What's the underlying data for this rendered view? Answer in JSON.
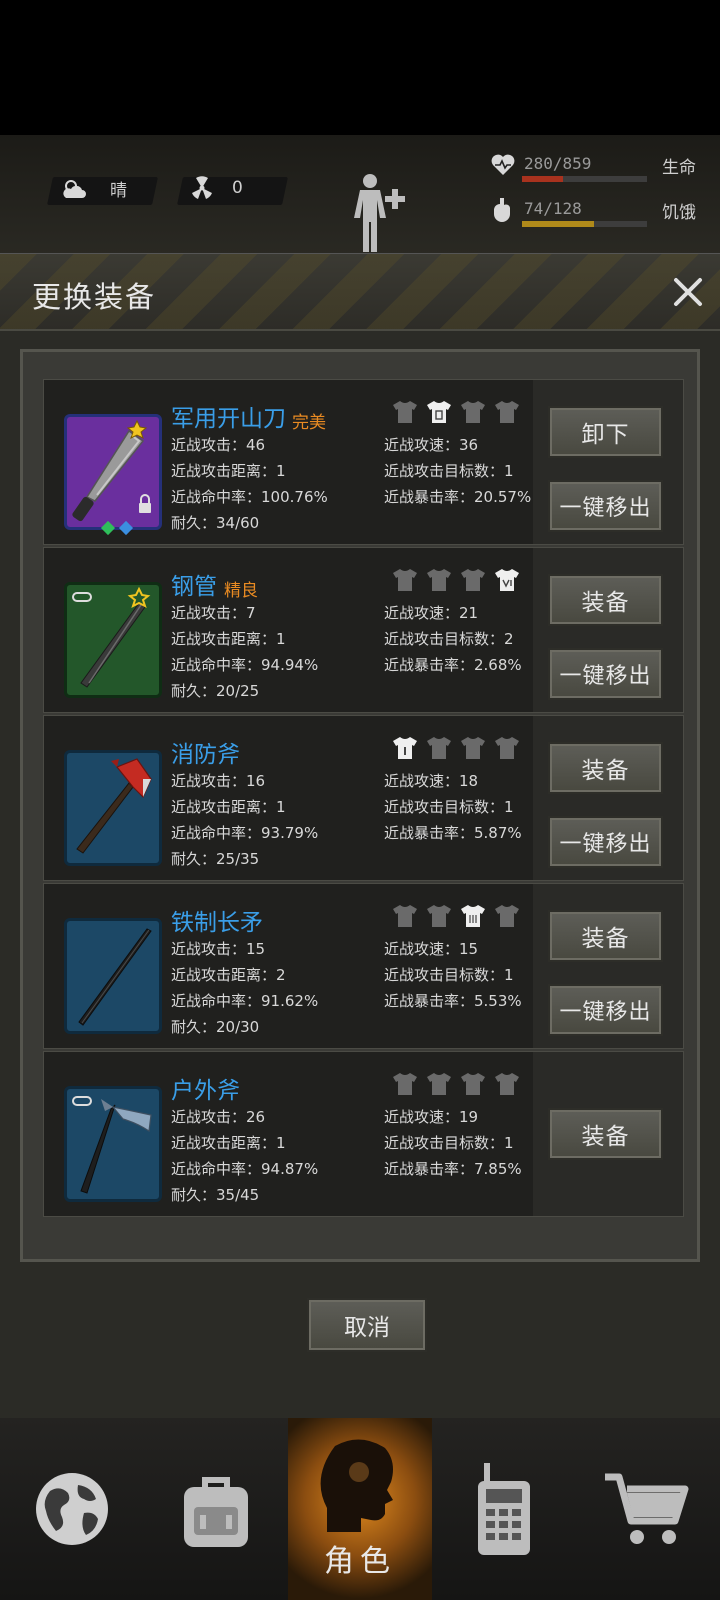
{
  "status": {
    "weather_label": "晴",
    "radiation_value": "0",
    "health_value": "280/859",
    "health_label": "生命",
    "health_level": 0.326,
    "hunger_value": "74/128",
    "hunger_label": "饥饿",
    "hunger_level": 0.578,
    "colors": {
      "health": "#a8321e",
      "hunger": "#b08a1a"
    }
  },
  "dialog": {
    "title": "更换装备",
    "cancel_label": "取消"
  },
  "items": [
    {
      "name": "军用开山刀",
      "quality": "完美",
      "melee_attack": "近战攻击：46",
      "melee_speed": "近战攻速：36",
      "melee_range": "近战攻击距离：1",
      "melee_targets": "近战攻击目标数：1",
      "melee_hit": "近战命中率：100.76%",
      "melee_crit": "近战暴击率：20.57%",
      "durability": "耐久：34/60",
      "primary_action": "卸下",
      "secondary_action": "一键移出",
      "rarity_color": "#6a2f9e",
      "icon": "machete-icon"
    },
    {
      "name": "钢管",
      "quality": "精良",
      "melee_attack": "近战攻击：7",
      "melee_speed": "近战攻速：21",
      "melee_range": "近战攻击距离：1",
      "melee_targets": "近战攻击目标数：2",
      "melee_hit": "近战命中率：94.94%",
      "melee_crit": "近战暴击率：2.68%",
      "durability": "耐久：20/25",
      "primary_action": "装备",
      "secondary_action": "一键移出",
      "rarity_color": "#23572a",
      "icon": "steel-pipe-icon"
    },
    {
      "name": "消防斧",
      "quality": "",
      "melee_attack": "近战攻击：16",
      "melee_speed": "近战攻速：18",
      "melee_range": "近战攻击距离：1",
      "melee_targets": "近战攻击目标数：1",
      "melee_hit": "近战命中率：93.79%",
      "melee_crit": "近战暴击率：5.87%",
      "durability": "耐久：25/35",
      "primary_action": "装备",
      "secondary_action": "一键移出",
      "rarity_color": "#1c4866",
      "icon": "fire-axe-icon"
    },
    {
      "name": "铁制长矛",
      "quality": "",
      "melee_attack": "近战攻击：15",
      "melee_speed": "近战攻速：15",
      "melee_range": "近战攻击距离：2",
      "melee_targets": "近战攻击目标数：1",
      "melee_hit": "近战命中率：91.62%",
      "melee_crit": "近战暴击率：5.53%",
      "durability": "耐久：20/30",
      "primary_action": "装备",
      "secondary_action": "一键移出",
      "rarity_color": "#1c4866",
      "icon": "spear-icon"
    },
    {
      "name": "户外斧",
      "quality": "",
      "melee_attack": "近战攻击：26",
      "melee_speed": "近战攻速：19",
      "melee_range": "近战攻击距离：1",
      "melee_targets": "近战攻击目标数：1",
      "melee_hit": "近战命中率：94.87%",
      "melee_crit": "近战暴击率：7.85%",
      "durability": "耐久：35/45",
      "primary_action": "装备",
      "rarity_color": "#1c4866",
      "icon": "outdoor-axe-icon"
    }
  ],
  "nav": {
    "active_label": "角色"
  }
}
